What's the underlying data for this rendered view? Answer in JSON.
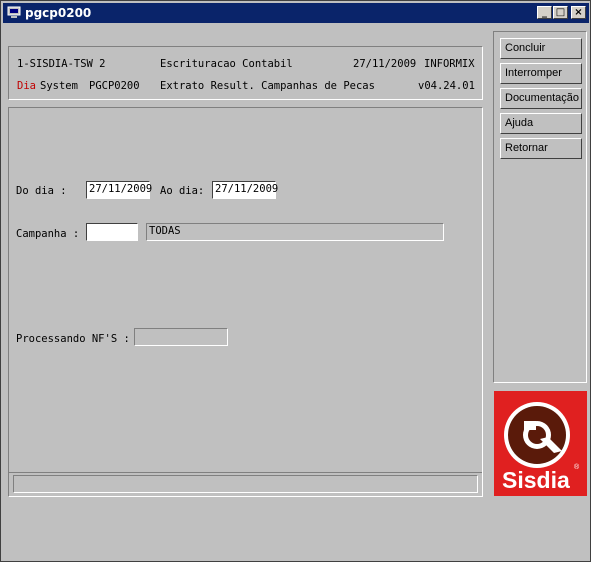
{
  "window": {
    "title": "pgcp0200",
    "controls": [
      "_",
      "□",
      "×"
    ]
  },
  "header": {
    "row1": {
      "system": "1-SISDIA-TSW 2",
      "module": "Escrituracao Contabil",
      "date": "27/11/2009",
      "db": "INFORMIX"
    },
    "row2": {
      "brand_red": "Dia",
      "brand_rest": "System",
      "program": "PGCP0200",
      "description": "Extrato Result. Campanhas de Pecas",
      "version": "v04.24.01"
    }
  },
  "form": {
    "do_dia_label": "Do dia   :",
    "do_dia_value": "27/11/2009",
    "ao_dia_label": "Ao dia:",
    "ao_dia_value": "27/11/2009",
    "campanha_label": "Campanha :",
    "campanha_value": "",
    "campanha_desc": "TODAS",
    "processando_label": "Processando NF'S :",
    "processando_value": ""
  },
  "statusbar": {
    "text": ""
  },
  "sidebar": {
    "buttons": [
      {
        "label": "Concluir"
      },
      {
        "label": "Interromper"
      },
      {
        "label": "Documentação"
      },
      {
        "label": "Ajuda"
      },
      {
        "label": "Retornar"
      }
    ]
  },
  "logo": {
    "text": "Sisdia",
    "mark": "®"
  },
  "colors": {
    "titlebar": "#0a246a",
    "logo_bg": "#e02020",
    "logo_dark": "#5a1a0a",
    "brand_red": "#c00000"
  }
}
